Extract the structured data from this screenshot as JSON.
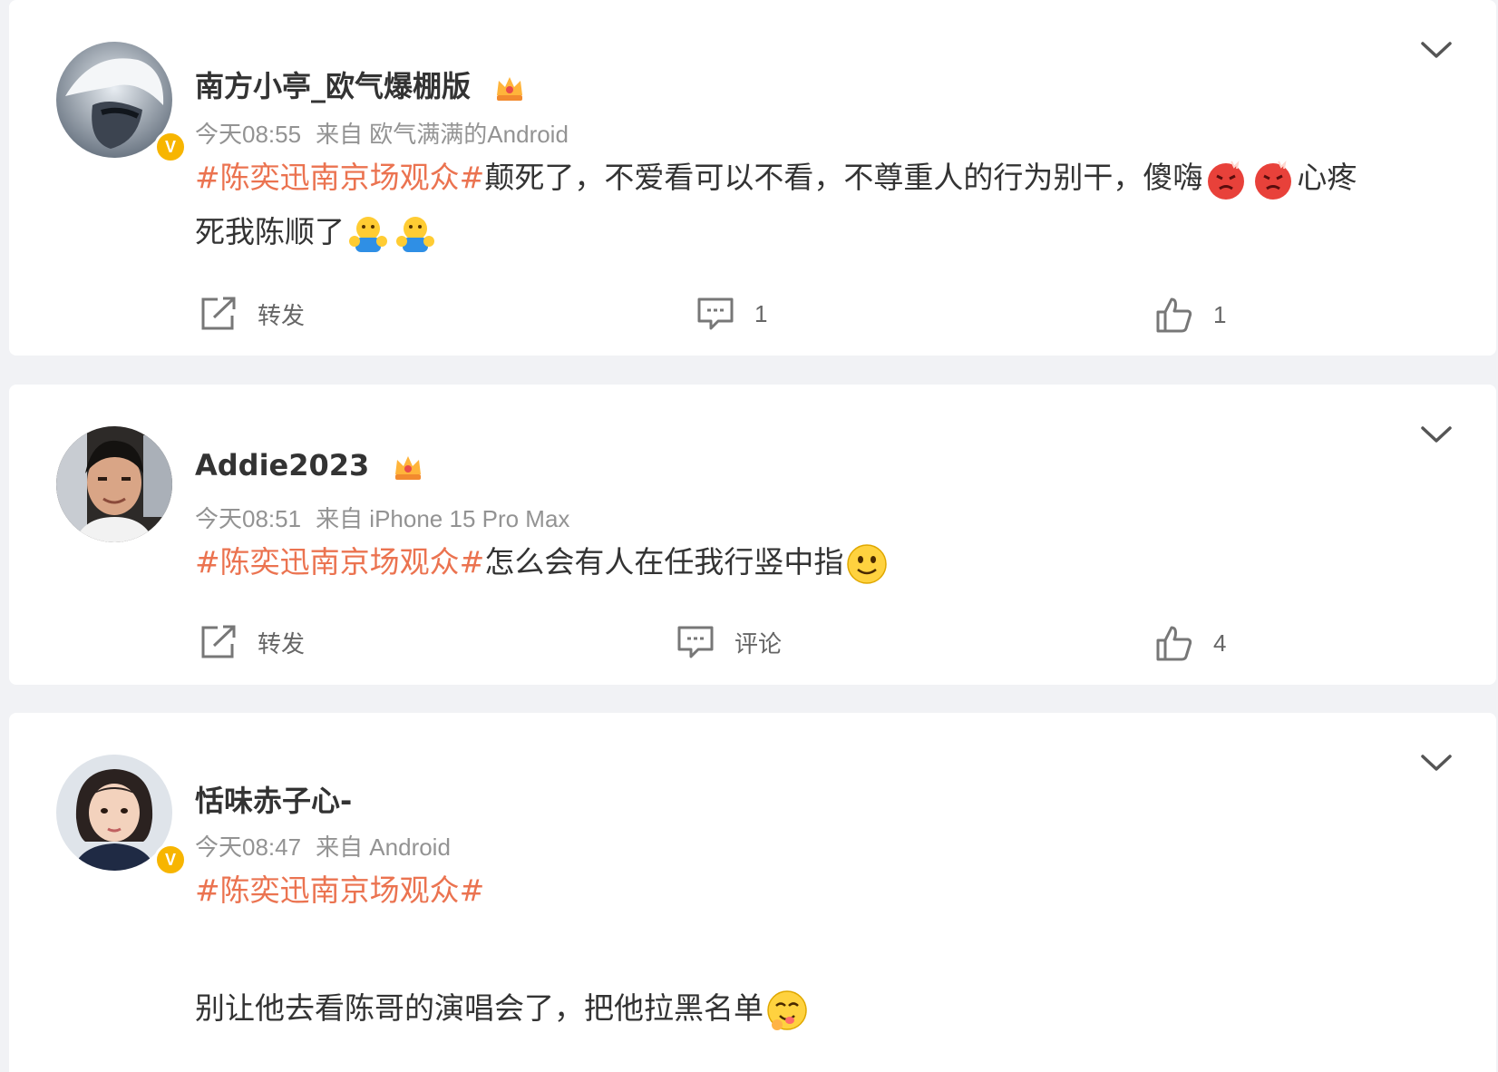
{
  "posts": [
    {
      "username": "南方小亭_欧气爆棚版",
      "verified": true,
      "time": "今天08:55",
      "source": "来自 欧气满满的Android",
      "hashtag": "#陈奕迅南京场观众#",
      "text_part1": "颠死了，不爱看可以不看，不尊重人的行为别干，傻嗨",
      "text_part2": "心疼",
      "text_part3": "死我陈顺了",
      "actions": {
        "repost": "转发",
        "comment": "1",
        "like": "1"
      }
    },
    {
      "username": "Addie2023",
      "verified": false,
      "time": "今天08:51",
      "source": "来自 iPhone 15 Pro Max",
      "hashtag": "#陈奕迅南京场观众#",
      "text_part1": "怎么会有人在任我行竖中指",
      "actions": {
        "repost": "转发",
        "comment": "评论",
        "like": "4"
      }
    },
    {
      "username": "恬味赤子心-",
      "verified": true,
      "time": "今天08:47",
      "source": "来自 Android",
      "hashtag": "#陈奕迅南京场观众#",
      "text_part1": "别让他去看陈哥的演唱会了，把他拉黑名单"
    }
  ],
  "icons": {
    "menu": "chevron-down-icon",
    "repost": "share-icon",
    "comment": "comment-icon",
    "like": "thumbs-up-icon"
  },
  "colors": {
    "hashtag": "#eb7350",
    "meta": "#939393",
    "vbadge": "#f7b500"
  }
}
